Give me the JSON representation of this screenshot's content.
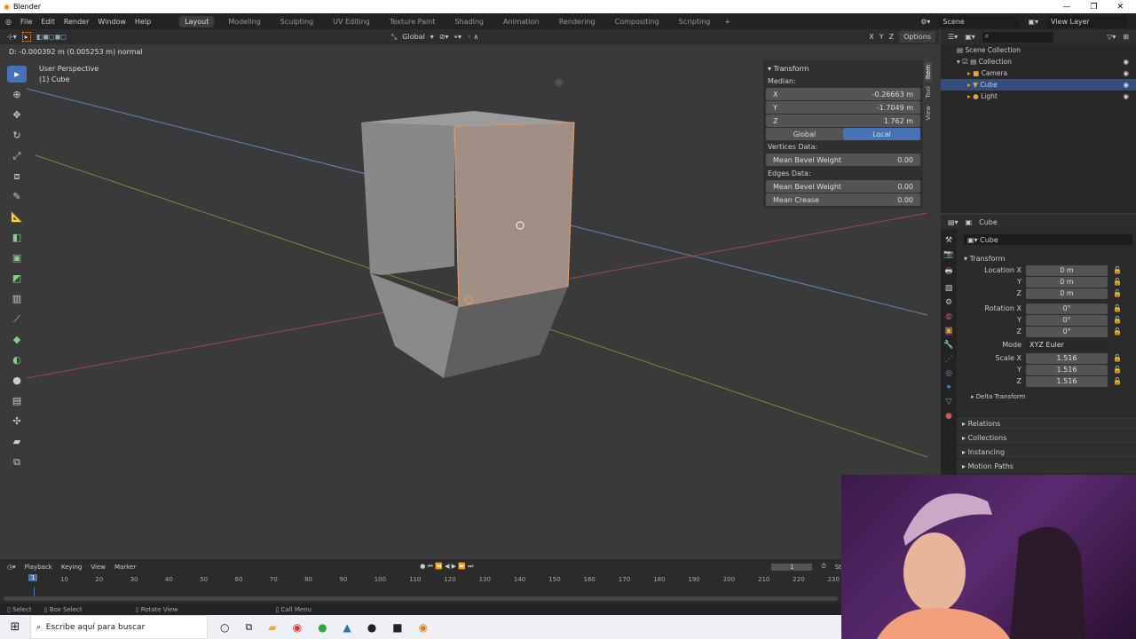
{
  "window": {
    "title": "Blender",
    "controls": [
      "—",
      "❐",
      "✕"
    ]
  },
  "menu": {
    "items": [
      "File",
      "Edit",
      "Render",
      "Window",
      "Help"
    ],
    "workspaces": [
      "Layout",
      "Modeling",
      "Sculpting",
      "UV Editing",
      "Texture Paint",
      "Shading",
      "Animation",
      "Rendering",
      "Compositing",
      "Scripting"
    ],
    "active_workspace": "Layout",
    "add": "+",
    "scene": "Scene",
    "view_layer": "View Layer"
  },
  "viewport_header": {
    "orientation": "Global",
    "options": "Options",
    "axes": [
      "X",
      "Y",
      "Z"
    ]
  },
  "viewport": {
    "header_text": "D: -0.000392 m (0.005253 m) normal",
    "view_name": "User Perspective",
    "object": "(1) Cube"
  },
  "npanel": {
    "title": "Transform",
    "median": "Median:",
    "x_label": "X",
    "x": "-0.26663 m",
    "y_label": "Y",
    "y": "-1.7049 m",
    "z_label": "Z",
    "z": "1.762 m",
    "global": "Global",
    "local": "Local",
    "vertices_data": "Vertices Data:",
    "mean_bevel_weight": "Mean Bevel Weight",
    "v_bevel": "0.00",
    "edges_data": "Edges Data:",
    "e_bevel": "0.00",
    "mean_crease": "Mean Crease",
    "crease": "0.00",
    "tabs": [
      "Item",
      "Tool",
      "View"
    ]
  },
  "outliner": {
    "search_placeholder": "",
    "items": [
      {
        "label": "Scene Collection"
      },
      {
        "label": "Collection"
      },
      {
        "label": "Camera"
      },
      {
        "label": "Cube"
      },
      {
        "label": "Light"
      }
    ]
  },
  "properties": {
    "header": "Cube",
    "object_name": "Cube",
    "transform": "Transform",
    "location_x": "Location X",
    "rotation_x": "Rotation X",
    "y": "Y",
    "z": "Z",
    "loc": [
      "0 m",
      "0 m",
      "0 m"
    ],
    "rot": [
      "0°",
      "0°",
      "0°"
    ],
    "mode_label": "Mode",
    "mode": "XYZ Euler",
    "scale_x": "Scale X",
    "scale": [
      "1.516",
      "1.516",
      "1.516"
    ],
    "delta": "Delta Transform",
    "sections": [
      "Relations",
      "Collections",
      "Instancing",
      "Motion Paths"
    ]
  },
  "timeline": {
    "menus": [
      "Playback",
      "Keying",
      "View",
      "Marker"
    ],
    "current_frame": "1",
    "ticks": [
      "10",
      "20",
      "30",
      "40",
      "50",
      "60",
      "70",
      "80",
      "90",
      "100",
      "110",
      "120",
      "130",
      "140",
      "150",
      "160",
      "170",
      "180",
      "190",
      "200",
      "210",
      "220",
      "230"
    ],
    "start": "St"
  },
  "status": {
    "select": "Select",
    "box_select": "Box Select",
    "rotate": "Rotate View",
    "call_menu": "Call Menu"
  },
  "taskbar": {
    "search_placeholder": "Escribe aquí para buscar"
  },
  "colors": {
    "accent": "#4772b3",
    "viewport": "#3a3a3a",
    "face_selected": "#a18f86"
  }
}
